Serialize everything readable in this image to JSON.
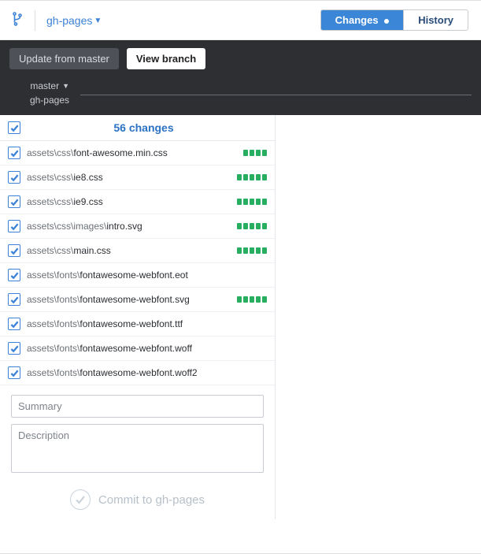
{
  "topbar": {
    "current_branch": "gh-pages",
    "tabs": {
      "changes": "Changes",
      "history": "History"
    }
  },
  "darkbar": {
    "update_btn": "Update from master",
    "view_btn": "View branch",
    "compare_top": "master",
    "compare_bottom": "gh-pages"
  },
  "changes": {
    "header": "56 changes",
    "files": [
      {
        "dir": "assets\\css\\",
        "name": "font-awesome.min.css",
        "blips": 4
      },
      {
        "dir": "assets\\css\\",
        "name": "ie8.css",
        "blips": 5
      },
      {
        "dir": "assets\\css\\",
        "name": "ie9.css",
        "blips": 5
      },
      {
        "dir": "assets\\css\\images\\",
        "name": "intro.svg",
        "blips": 5
      },
      {
        "dir": "assets\\css\\",
        "name": "main.css",
        "blips": 5
      },
      {
        "dir": "assets\\fonts\\",
        "name": "fontawesome-webfont.eot",
        "blips": 0
      },
      {
        "dir": "assets\\fonts\\",
        "name": "fontawesome-webfont.svg",
        "blips": 5
      },
      {
        "dir": "assets\\fonts\\",
        "name": "fontawesome-webfont.ttf",
        "blips": 0
      },
      {
        "dir": "assets\\fonts\\",
        "name": "fontawesome-webfont.woff",
        "blips": 0
      },
      {
        "dir": "assets\\fonts\\",
        "name": "fontawesome-webfont.woff2",
        "blips": 0
      }
    ]
  },
  "commit": {
    "summary_placeholder": "Summary",
    "description_placeholder": "Description",
    "button_label": "Commit to gh-pages"
  }
}
